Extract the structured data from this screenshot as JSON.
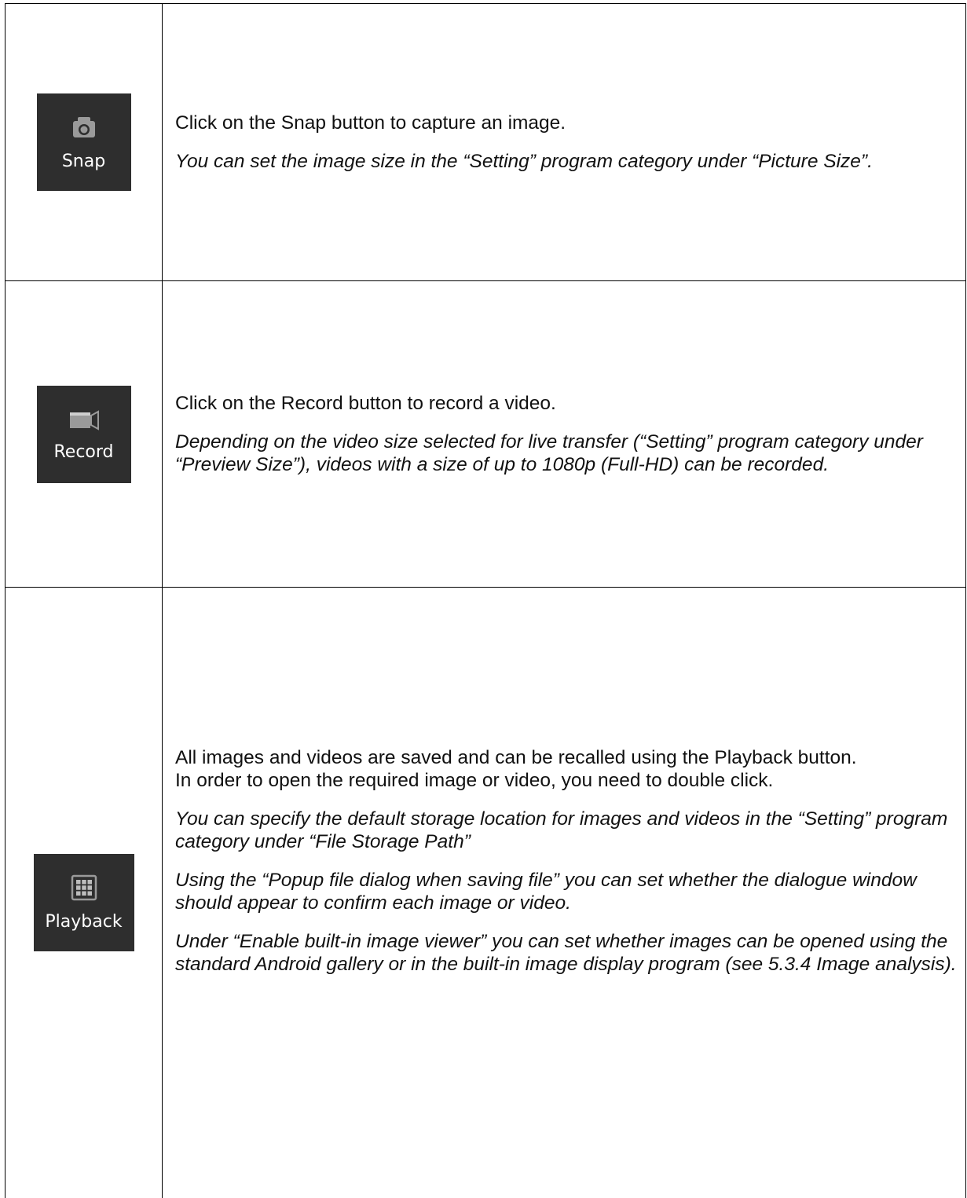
{
  "rows": [
    {
      "button_label": "Snap",
      "button_icon": "camera-icon",
      "main_text": "Click on the Snap button to capture an image.",
      "note_text": "You can set the image size in the “Setting” program category under “Picture Size”."
    },
    {
      "button_label": "Record",
      "button_icon": "video-camera-icon",
      "main_text": "Click on the Record button to record a video.",
      "note_text": "Depending on the video size selected for live transfer (“Setting” program category under “Preview Size”), videos with a size of up to 1080p (Full-HD) can be recorded."
    },
    {
      "button_label": "Playback",
      "button_icon": "grid-icon",
      "main_text_line1": "All images and videos are saved and can be recalled using the Playback button.",
      "main_text_line2": "In order to open the required image or video, you need to double click.",
      "note_text_1": "You can specify the default storage location for images and videos in the “Setting” program category under “File Storage Path”",
      "note_text_2": "Using the “Popup file dialog when saving file” you can set whether the dialogue window should appear to confirm each image or video.",
      "note_text_3": "Under “Enable built-in image viewer” you can set whether images can be opened using the standard Android gallery or in the built-in image display program (see 5.3.4 Image analysis)."
    }
  ],
  "colors": {
    "button_bg": "#2e2e2e",
    "button_text": "#ffffff",
    "border": "#000000"
  }
}
